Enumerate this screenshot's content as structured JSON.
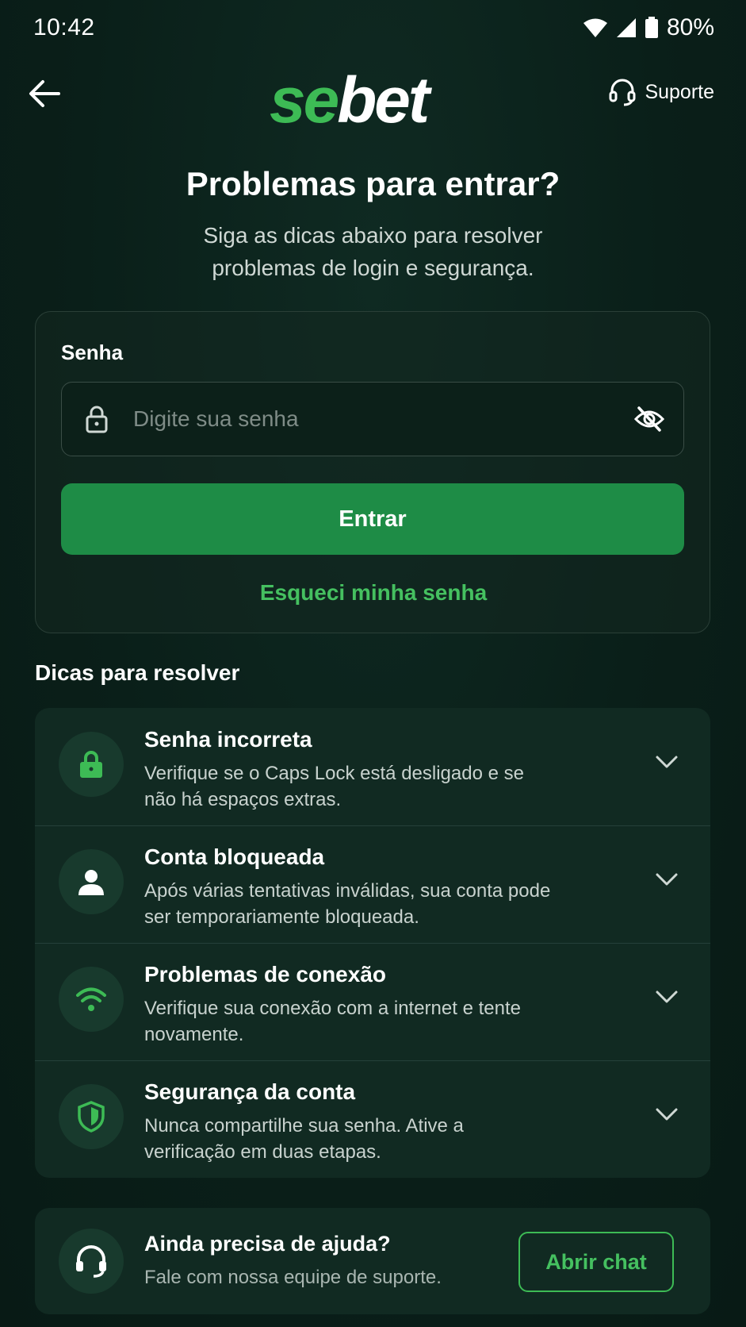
{
  "status": {
    "time": "10:42",
    "battery": "80%"
  },
  "header": {
    "logo_part1": "se",
    "logo_part2": "bet",
    "support_label": "Suporte"
  },
  "page": {
    "title": "Problemas para entrar?",
    "subtitle": "Siga as dicas abaixo para resolver problemas de login e segurança."
  },
  "login": {
    "password_label": "Senha",
    "password_placeholder": "Digite sua senha",
    "submit_label": "Entrar",
    "forgot_label": "Esqueci minha senha"
  },
  "tips": {
    "section_title": "Dicas para resolver",
    "items": [
      {
        "title": "Senha incorreta",
        "desc": "Verifique se o Caps Lock está desligado e se não há espaços extras.",
        "icon": "lock-icon"
      },
      {
        "title": "Conta bloqueada",
        "desc": "Após várias tentativas inválidas, sua conta pode ser temporariamente bloqueada.",
        "icon": "user-icon"
      },
      {
        "title": "Problemas de conexão",
        "desc": "Verifique sua conexão com a internet e tente novamente.",
        "icon": "wifi-icon"
      },
      {
        "title": "Segurança da conta",
        "desc": "Nunca compartilhe sua senha. Ative a verificação em duas etapas.",
        "icon": "shield-icon"
      }
    ]
  },
  "help": {
    "title": "Ainda precisa de ajuda?",
    "desc": "Fale com nossa equipe de suporte.",
    "chat_label": "Abrir chat"
  },
  "colors": {
    "accent": "#3dbb55",
    "button": "#1e8c46",
    "background": "#0a1f19"
  }
}
